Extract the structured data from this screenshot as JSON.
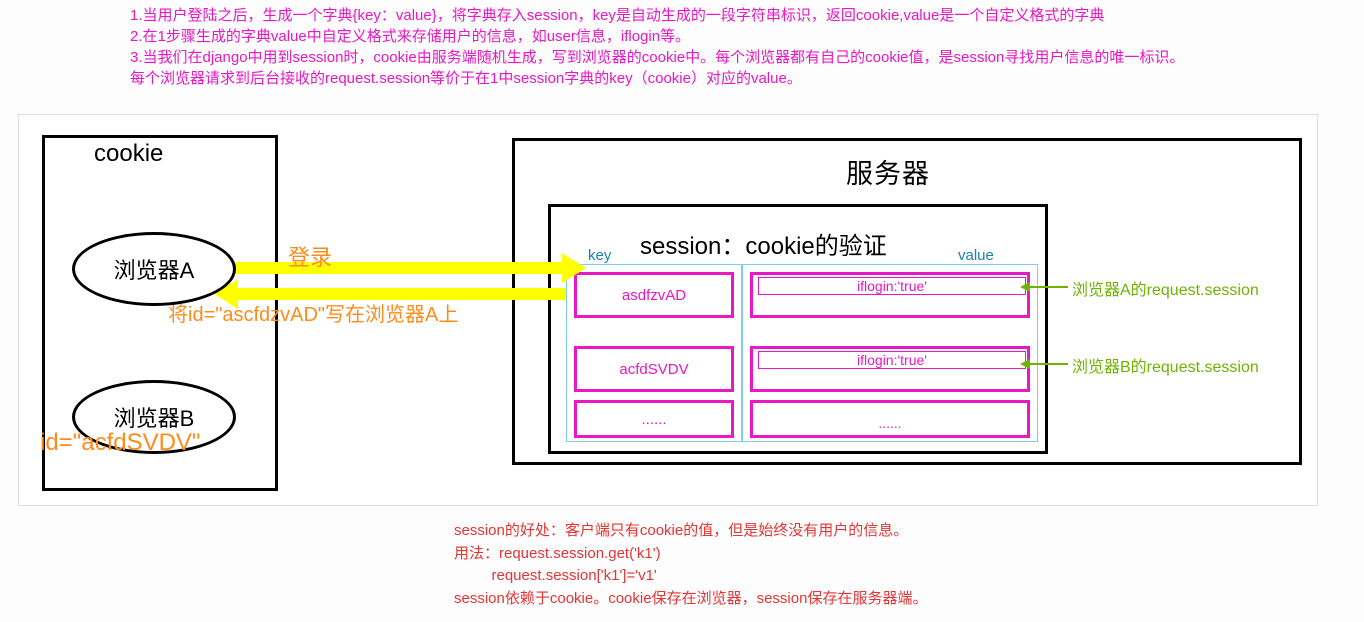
{
  "top": {
    "line1": "1.当用户登陆之后，生成一个字典{key：value}，将字典存入session，key是自动生成的一段字符串标识，返回cookie,value是一个自定义格式的字典",
    "line2": "2.在1步骤生成的字典value中自定义格式来存储用户的信息，如user信息，iflogin等。",
    "line3": "3.当我们在django中用到session时，cookie由服务端随机生成，写到浏览器的cookie中。每个浏览器都有自己的cookie值，是session寻找用户信息的唯一标识。",
    "line4": "每个浏览器请求到后台接收的request.session等价于在1中session字典的key（cookie）对应的value。"
  },
  "cookie": {
    "title": "cookie",
    "browserA": "浏览器A",
    "browserB": "浏览器B",
    "idB": "id=\"acfdSVDV\""
  },
  "server": {
    "title": "服务器",
    "sessionTitle": "session：cookie的验证",
    "keyLabel": "key",
    "valueLabel": "value",
    "rows": {
      "k1": "asdfzvAD",
      "v1": "iflogin:'true'",
      "k2": "acfdSVDV",
      "v2": "iflogin:'true'",
      "k3": "......",
      "v3": "......"
    }
  },
  "arrows": {
    "login": "登录",
    "write": "将id=\"ascfdzvAD\"写在浏览器A上",
    "reqA": "浏览器A的request.session",
    "reqB": "浏览器B的request.session"
  },
  "bottom": {
    "l1": "session的好处：客户端只有cookie的值，但是始终没有用户的信息。",
    "l2": "用法：request.session.get('k1')",
    "l3": "         request.session['k1']='v1'",
    "l4": "session依赖于cookie。cookie保存在浏览器，session保存在服务器端。"
  }
}
